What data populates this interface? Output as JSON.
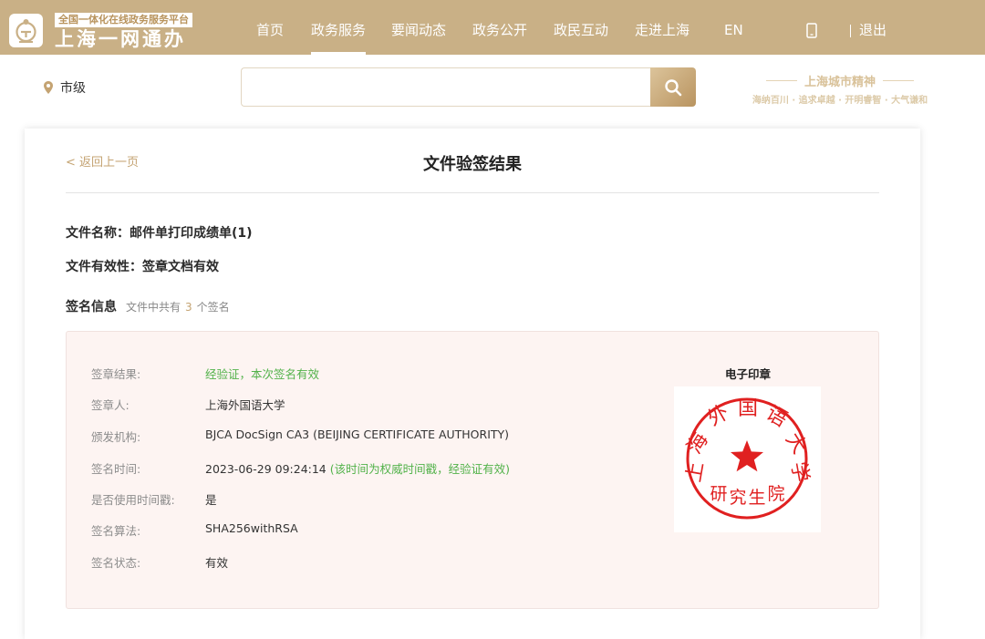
{
  "header": {
    "logo_subtitle": "全国一体化在线政务服务平台",
    "logo_title": "上海一网通办",
    "nav": [
      "首页",
      "政务服务",
      "要闻动态",
      "政务公开",
      "政民互动",
      "走进上海",
      "EN"
    ],
    "active_nav": "政务服务",
    "logout_label": "退出",
    "brand_color": "#c9b086",
    "icons": [
      "logo-icon",
      "phone-icon"
    ]
  },
  "search": {
    "location_label": "市级",
    "location_icon": "location-pin-icon",
    "placeholder": "",
    "search_icon": "search-icon",
    "slogan_title": "上海城市精神",
    "slogan_sub": "海纳百川 · 追求卓越 · 开明睿智 · 大气谦和"
  },
  "page": {
    "back_label": "< 返回上一页",
    "title": "文件验签结果",
    "file_name_label": "文件名称：",
    "file_name": "邮件单打印成绩单(1)",
    "validity_label": "文件有效性：",
    "validity": "签章文档有效",
    "sig_section_title": "签名信息",
    "sig_count_prefix": "文件中共有",
    "sig_count": "3",
    "sig_count_suffix": "个签名"
  },
  "signature": {
    "result_label": "签章结果:",
    "result_value": "经验证，本次签名有效",
    "signer_label": "签章人:",
    "signer_value": "上海外国语大学",
    "issuer_label": "颁发机构:",
    "issuer_value": "BJCA DocSign CA3 (BEIJING CERTIFICATE AUTHORITY)",
    "time_label": "签名时间:",
    "time_value": "2023-06-29 09:24:14",
    "time_note": "(该时间为权威时间戳，经验证有效)",
    "timestamp_label": "是否使用时间戳:",
    "timestamp_value": "是",
    "algo_label": "签名算法:",
    "algo_value": "SHA256withRSA",
    "status_label": "签名状态:",
    "status_value": "有效",
    "seal_title": "电子印章",
    "seal_top_text": "上海外国语大学",
    "seal_bottom_text": "研究生院",
    "seal_color": "#e02020",
    "success_color": "#52b24a",
    "accent_color": "#c4a372"
  }
}
